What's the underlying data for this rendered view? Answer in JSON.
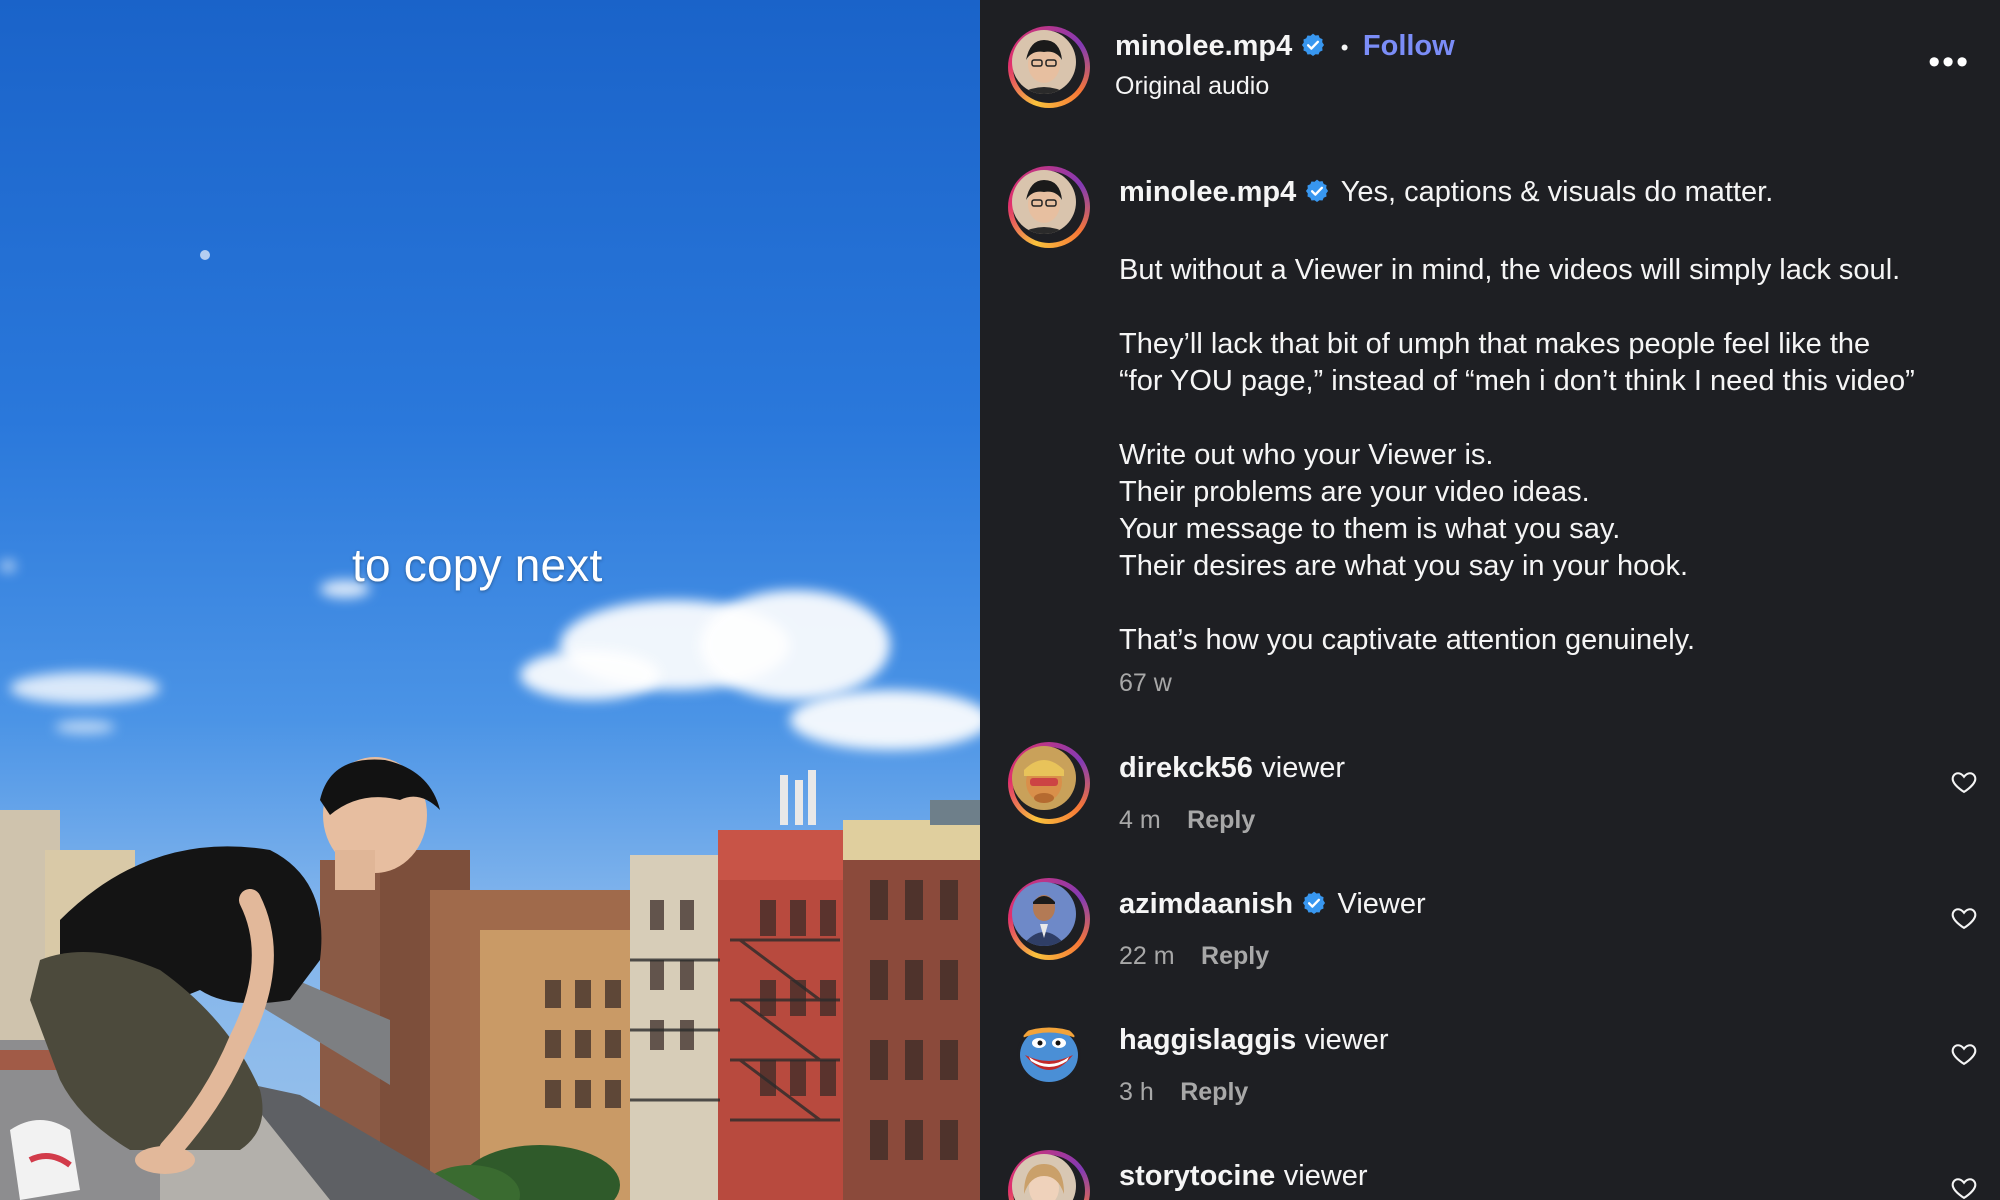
{
  "video": {
    "caption": "to copy next"
  },
  "header": {
    "username": "minolee.mp4",
    "separator": "•",
    "follow_label": "Follow",
    "audio_label": "Original audio",
    "more_label": "•••"
  },
  "post": {
    "username": "minolee.mp4",
    "first_line": "Yes, captions & visuals do matter.",
    "paragraphs": [
      [
        "But without a Viewer in mind, the videos will simply lack soul."
      ],
      [
        "They’ll lack that bit of umph that makes people feel like the",
        "“for YOU page,” instead of “meh i don’t think I need this video”"
      ],
      [
        "Write out who your Viewer is.",
        "Their problems are your video ideas.",
        "Your message to them is what you say.",
        "Their desires are what you say in your hook."
      ],
      [
        "That’s how you captivate attention genuinely."
      ]
    ],
    "time": "67 w"
  },
  "comments": [
    {
      "username": "direkck56",
      "text": "viewer",
      "time": "4 m",
      "reply": "Reply",
      "verified": false
    },
    {
      "username": "azimdaanish",
      "text": "Viewer",
      "time": "22 m",
      "reply": "Reply",
      "verified": true
    },
    {
      "username": "haggislaggis",
      "text": "viewer",
      "time": "3 h",
      "reply": "Reply",
      "verified": false
    },
    {
      "username": "storytocine",
      "text": "viewer",
      "time": "",
      "reply": "",
      "verified": false
    }
  ],
  "colors": {
    "panel_bg": "#1e1f23",
    "follow": "#7b8df7",
    "verified": "#3897f0",
    "muted": "#a8a8a8"
  },
  "icons": {
    "verified": "verified-badge-icon",
    "like": "heart-icon",
    "more": "more-options-icon"
  }
}
